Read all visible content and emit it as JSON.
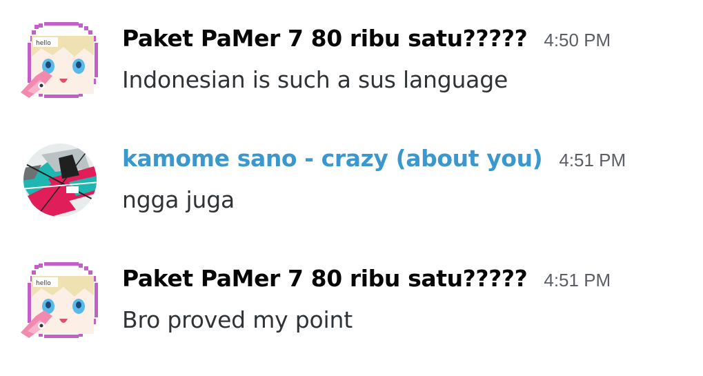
{
  "messages": [
    {
      "username": "Paket PaMer 7 80 ribu satu?????",
      "timestamp": "4:50 PM",
      "content": "Indonesian is such a sus language",
      "avatar": {
        "icon": "anime-girl-avatar-with-pixel-frame",
        "frame_caption": "hello",
        "frame_color": "#c060c8"
      }
    },
    {
      "username": "kamome sano - crazy (about you)",
      "timestamp": "4:51 PM",
      "content": "ngga juga",
      "username_color": "#3b98cf",
      "avatar": {
        "icon": "abstract-art-avatar",
        "colors": [
          "#e01e5a",
          "#1fb5b0",
          "#202020"
        ]
      }
    },
    {
      "username": "Paket PaMer 7 80 ribu satu?????",
      "timestamp": "4:51 PM",
      "content": "Bro proved my point",
      "avatar": {
        "icon": "anime-girl-avatar-with-pixel-frame",
        "frame_caption": "hello",
        "frame_color": "#c060c8"
      }
    }
  ]
}
